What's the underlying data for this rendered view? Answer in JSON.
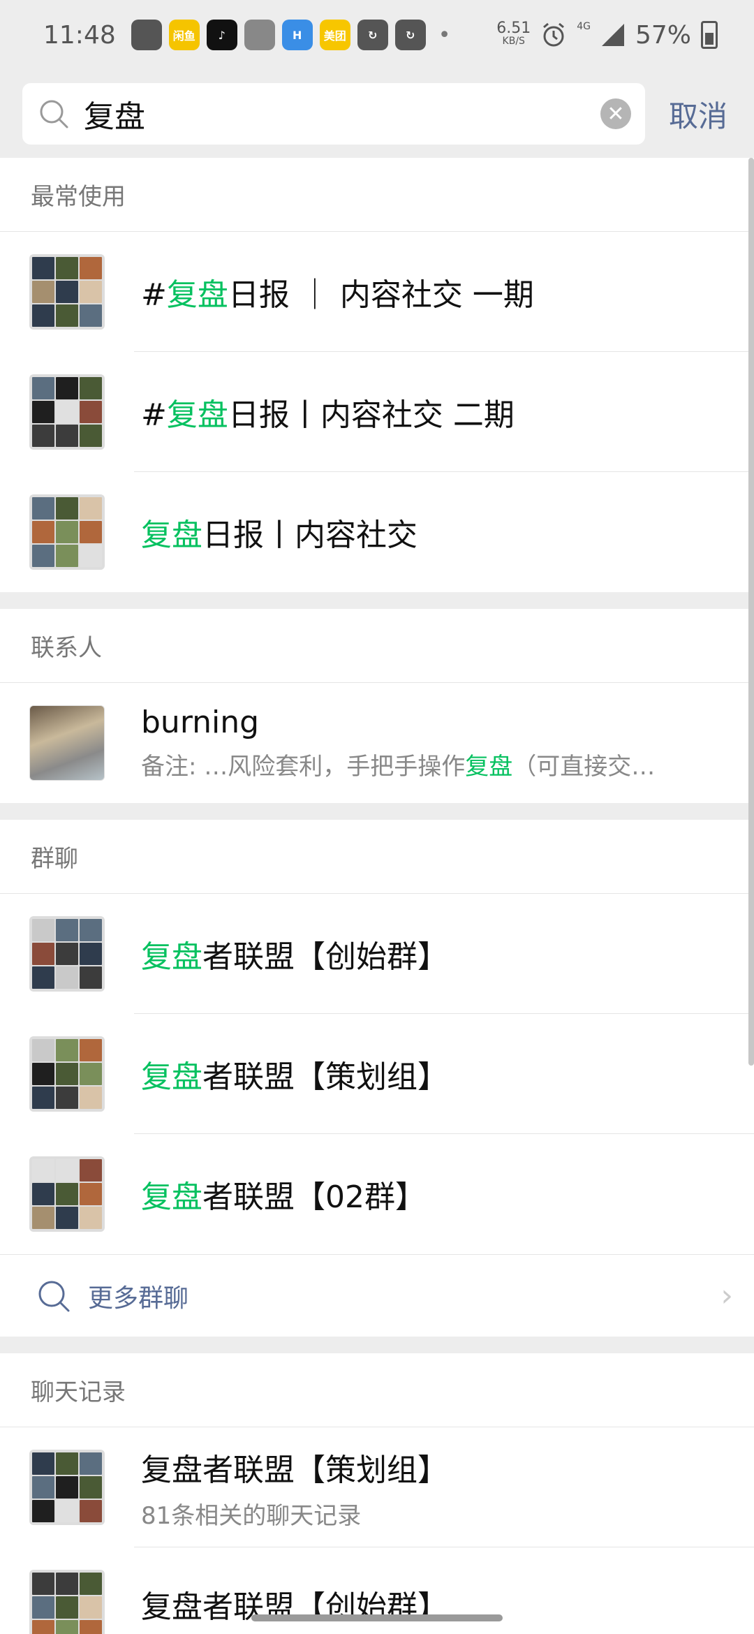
{
  "status_bar": {
    "time": "11:48",
    "net_speed_value": "6.51",
    "net_speed_unit": "KB/S",
    "network": "4G",
    "battery": "57%",
    "app_icons": [
      {
        "name": "nav-arrow-icon",
        "color": "#555555",
        "label": ""
      },
      {
        "name": "xianyu-icon",
        "color": "#f5c400",
        "label": "闲鱼"
      },
      {
        "name": "tiktok-icon",
        "color": "#111111",
        "label": "♪"
      },
      {
        "name": "document-icon",
        "color": "#888888",
        "label": ""
      },
      {
        "name": "h-app-icon",
        "color": "#3a8ee6",
        "label": "H"
      },
      {
        "name": "meituan-icon",
        "color": "#f7c600",
        "label": "美团"
      },
      {
        "name": "refresh-app-icon",
        "color": "#555555",
        "label": "↻"
      },
      {
        "name": "refresh-app-2-icon",
        "color": "#555555",
        "label": "↻"
      }
    ]
  },
  "search": {
    "value": "复盘",
    "cancel_label": "取消"
  },
  "sections": {
    "frequent": {
      "title": "最常使用",
      "items": [
        {
          "prefix": "#",
          "highlight": "复盘",
          "rest": "日报 ｜ 内容社交 一期"
        },
        {
          "prefix": "#",
          "highlight": "复盘",
          "rest": "日报丨内容社交 二期"
        },
        {
          "prefix": "",
          "highlight": "复盘",
          "rest": "日报丨内容社交"
        }
      ]
    },
    "contacts": {
      "title": "联系人",
      "items": [
        {
          "name": "burning",
          "sub_prefix": "备注: …风险套利，手把手操作",
          "sub_highlight": "复盘",
          "sub_rest": "（可直接交…"
        }
      ]
    },
    "groups": {
      "title": "群聊",
      "items": [
        {
          "highlight": "复盘",
          "rest": "者联盟【创始群】"
        },
        {
          "highlight": "复盘",
          "rest": "者联盟【策划组】"
        },
        {
          "highlight": "复盘",
          "rest": "者联盟【02群】"
        }
      ],
      "more_label": "更多群聊"
    },
    "chat_history": {
      "title": "聊天记录",
      "items": [
        {
          "title": "复盘者联盟【策划组】",
          "sub": "81条相关的聊天记录"
        },
        {
          "title": "复盘者联盟【创始群】",
          "sub": ""
        }
      ]
    }
  },
  "colors": {
    "highlight": "#07c160",
    "link": "#576b95",
    "background": "#ededed"
  }
}
